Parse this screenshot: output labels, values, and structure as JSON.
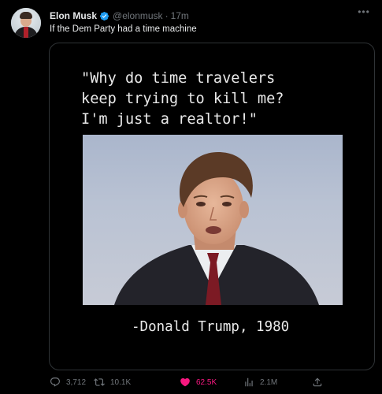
{
  "author": {
    "name": "Elon Musk",
    "handle": "@elonmusk",
    "separator": "·",
    "time": "17m",
    "verified": true
  },
  "tweet": {
    "text": "If the Dem Party had a time machine"
  },
  "media": {
    "quote_lines": [
      "\"Why do time travelers",
      "keep trying to kill me?",
      "I'm just a realtor!\""
    ],
    "attribution": "-Donald Trump, 1980"
  },
  "actions": {
    "reply_count": "3,712",
    "retweet_count": "10.1K",
    "like_count": "62.5K",
    "views_count": "2.1M"
  },
  "colors": {
    "background": "#000000",
    "text": "#e7e9ea",
    "muted": "#71767b",
    "verified": "#1d9bf0",
    "like": "#f91880",
    "border": "#2f3336"
  },
  "icons": [
    "more-icon",
    "verified-badge-icon",
    "reply-icon",
    "retweet-icon",
    "heart-icon",
    "views-icon",
    "share-icon"
  ]
}
